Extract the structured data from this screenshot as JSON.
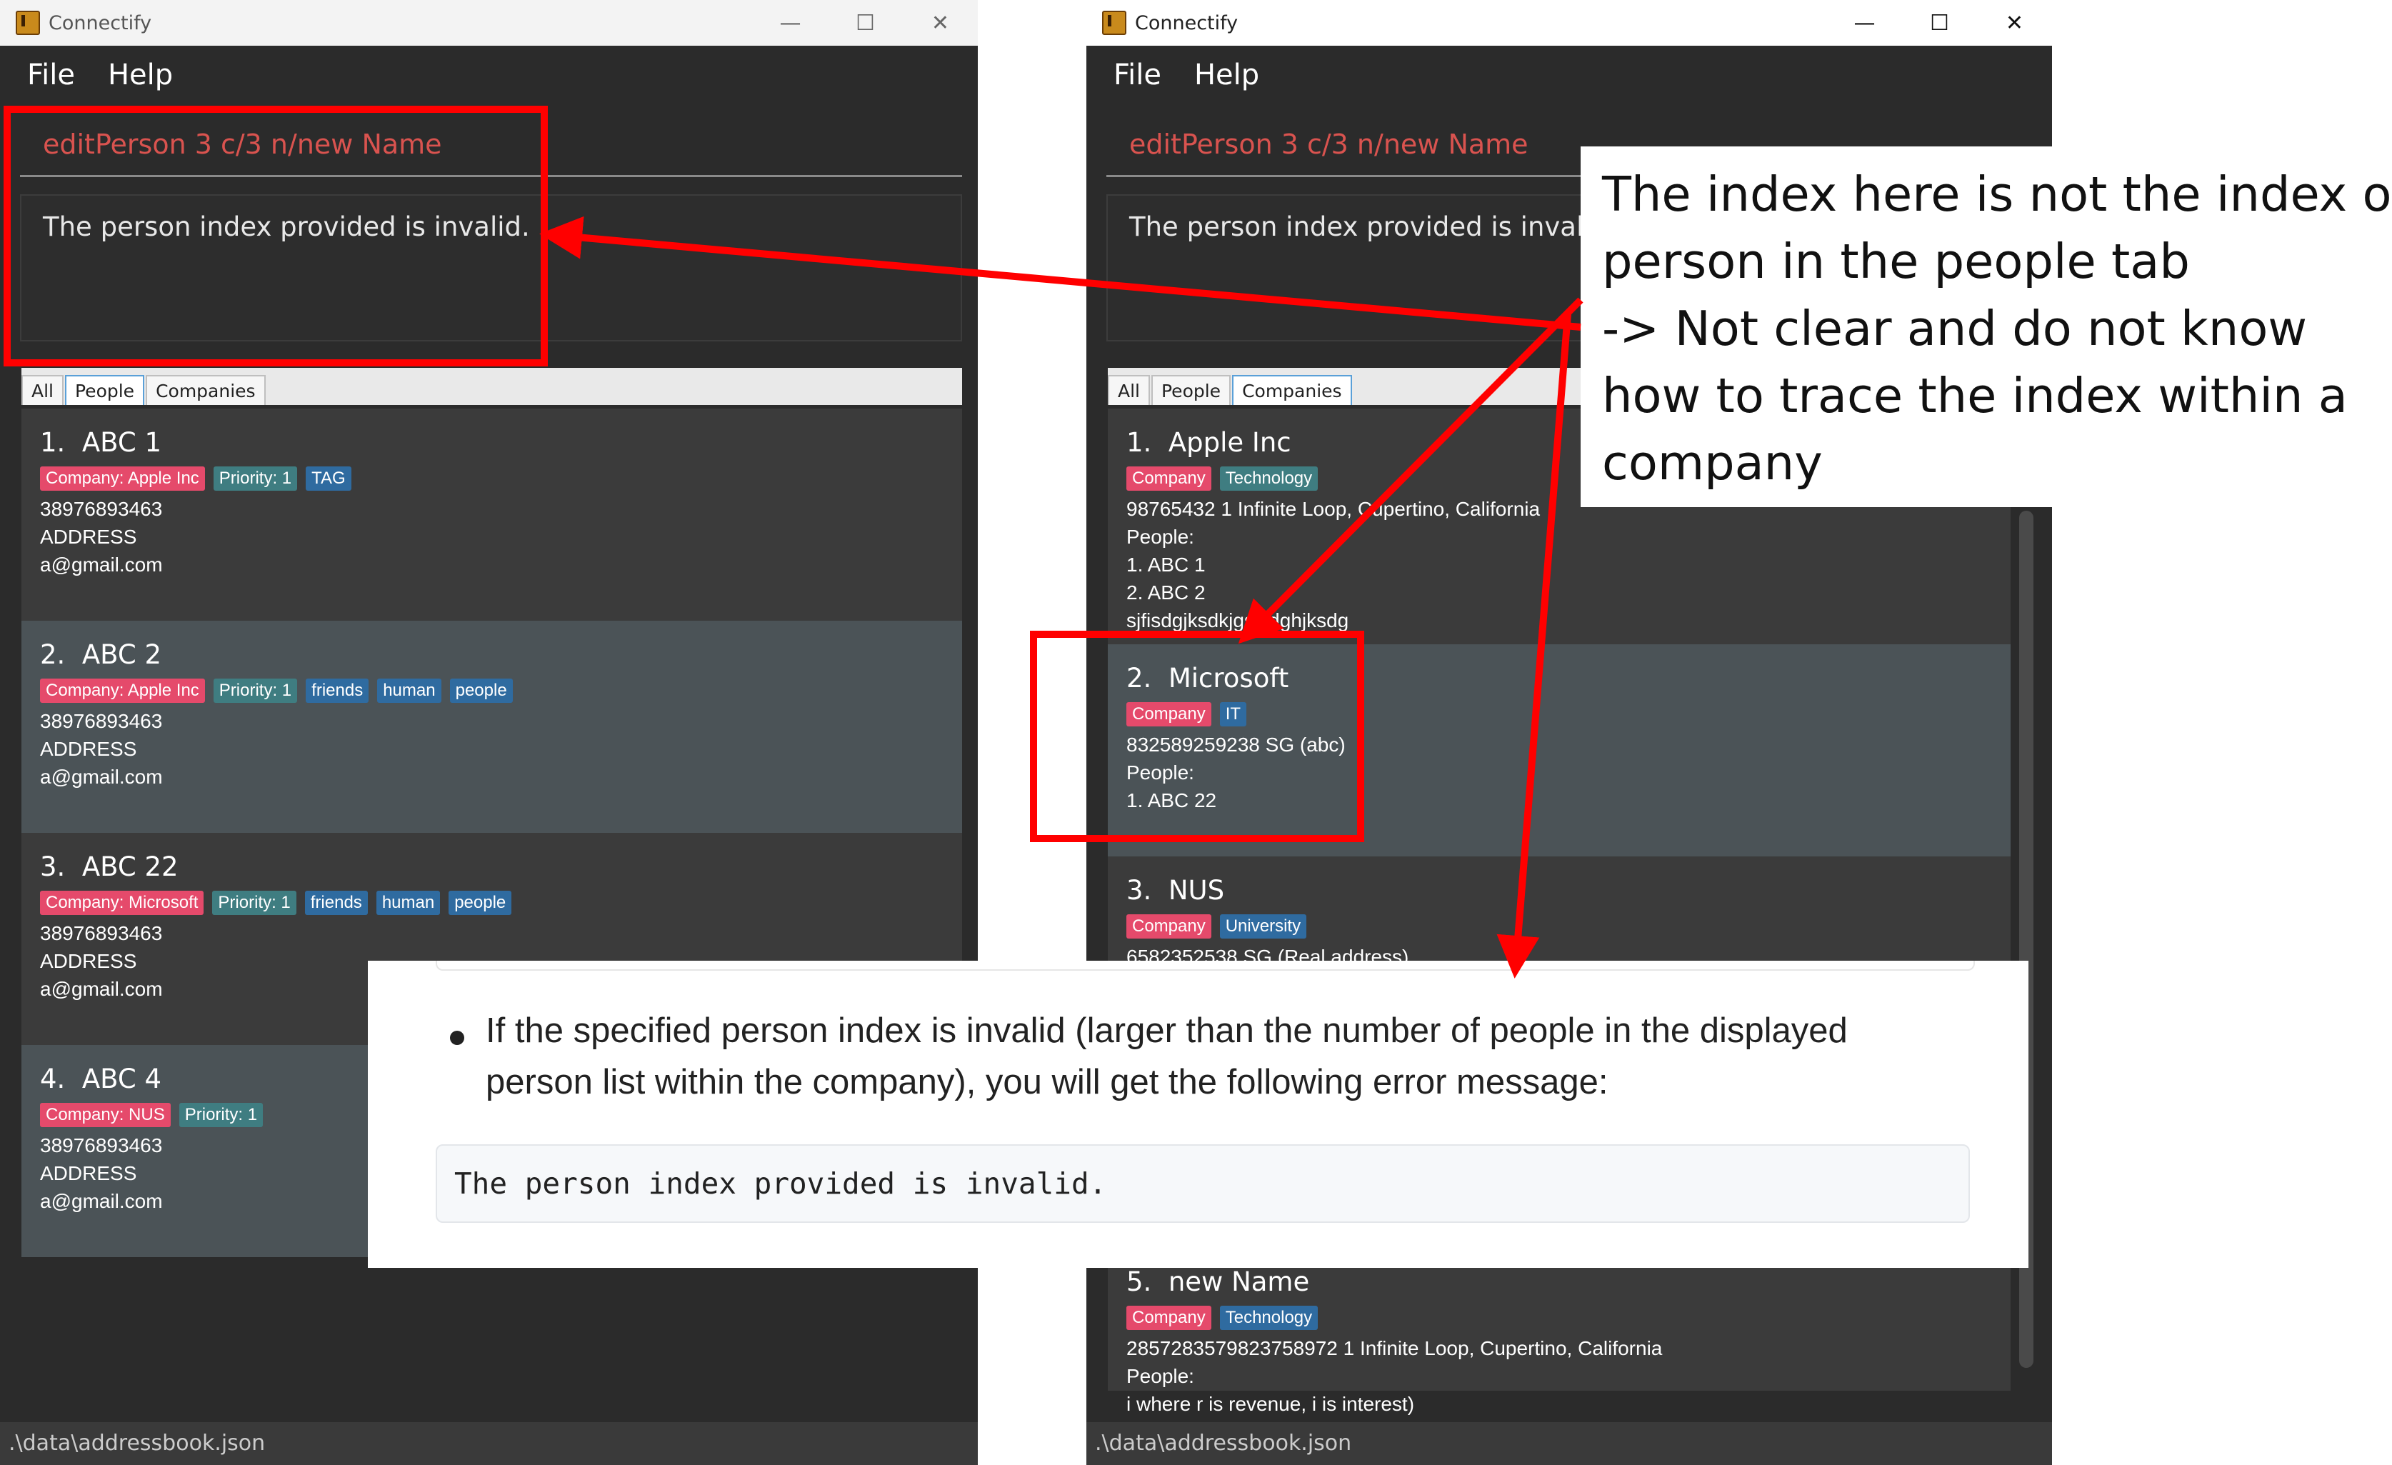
{
  "app": {
    "title": "Connectify",
    "menu": [
      "File",
      "Help"
    ],
    "status_path": ".\\data\\addressbook.json"
  },
  "window_controls": {
    "minimize": "—",
    "maximize": "☐",
    "close": "✕"
  },
  "left_window": {
    "command": "editPerson 3 c/3 n/new Name",
    "result": "The person index provided is invalid.",
    "tabs": [
      "All",
      "People",
      "Companies"
    ],
    "selected_tab": "All",
    "persons": [
      {
        "index": "1.",
        "name": "ABC 1",
        "tags": [
          {
            "text": "Company: Apple Inc",
            "kind": "company"
          },
          {
            "text": "Priority: 1",
            "kind": "priority"
          },
          {
            "text": "TAG",
            "kind": "normal"
          }
        ],
        "phone": "38976893463",
        "address": "ADDRESS",
        "email": "a@gmail.com"
      },
      {
        "index": "2.",
        "name": "ABC 2",
        "tags": [
          {
            "text": "Company: Apple Inc",
            "kind": "company"
          },
          {
            "text": "Priority: 1",
            "kind": "priority"
          },
          {
            "text": "friends",
            "kind": "normal"
          },
          {
            "text": "human",
            "kind": "normal"
          },
          {
            "text": "people",
            "kind": "normal"
          }
        ],
        "phone": "38976893463",
        "address": "ADDRESS",
        "email": "a@gmail.com"
      },
      {
        "index": "3.",
        "name": "ABC 22",
        "tags": [
          {
            "text": "Company: Microsoft",
            "kind": "company"
          },
          {
            "text": "Priority: 1",
            "kind": "priority"
          },
          {
            "text": "friends",
            "kind": "normal"
          },
          {
            "text": "human",
            "kind": "normal"
          },
          {
            "text": "people",
            "kind": "normal"
          }
        ],
        "phone": "38976893463",
        "address": "ADDRESS",
        "email": "a@gmail.com"
      },
      {
        "index": "4.",
        "name": "ABC 4",
        "tags": [
          {
            "text": "Company: NUS",
            "kind": "company"
          },
          {
            "text": "Priority: 1",
            "kind": "priority"
          }
        ],
        "phone": "38976893463",
        "address": "ADDRESS",
        "email": "a@gmail.com"
      }
    ]
  },
  "right_window": {
    "command": "editPerson 3 c/3 n/new Name",
    "result": "The person index provided is invalid.",
    "tabs": [
      "All",
      "People",
      "Companies"
    ],
    "selected_tab": "Companies",
    "companies": [
      {
        "index": "1.",
        "name": "Apple Inc",
        "tags": [
          {
            "text": "Company",
            "kind": "company"
          },
          {
            "text": "Technology",
            "kind": "priority"
          }
        ],
        "details": "98765432  1 Infinite Loop, Cupertino, California",
        "people_label": "People:",
        "people": [
          "1. ABC 1",
          "2. ABC 2"
        ],
        "extra": "sjfisdgjksdkjgsjsdghjksdg"
      },
      {
        "index": "2.",
        "name": "Microsoft",
        "tags": [
          {
            "text": "Company",
            "kind": "company"
          },
          {
            "text": "IT",
            "kind": "normal"
          }
        ],
        "details": "832589259238  SG (abc)",
        "people_label": "People:",
        "people": [
          "1. ABC 22"
        ]
      },
      {
        "index": "3.",
        "name": "NUS",
        "tags": [
          {
            "text": "Company",
            "kind": "company"
          },
          {
            "text": "University",
            "kind": "normal"
          }
        ],
        "details": "6582352538  SG (Real address)"
      },
      {
        "index": "5.",
        "name": "new Name",
        "tags": [
          {
            "text": "Company",
            "kind": "company"
          },
          {
            "text": "Technology",
            "kind": "normal"
          }
        ],
        "details": "2857283579823758972  1 Infinite Loop, Cupertino, California",
        "people_label": "People:",
        "extra": "i where r is revenue, i is interest)"
      }
    ]
  },
  "annotation": {
    "lines": [
      "The index here is not the index of",
      "person in the people tab",
      "-> Not clear and do not know",
      "how to trace the index within a",
      "company"
    ]
  },
  "doc_excerpt": {
    "bullet": "If the specified person index is invalid (larger than the number of people in the displayed person list within the company), you will get the following error message:",
    "code": "The person index provided is invalid."
  },
  "colors": {
    "highlight": "#ff0000",
    "company_tag": "#e54a6b",
    "priority_tag": "#3f7d81",
    "tag": "#2f6ba0",
    "error_text": "#d9534f"
  }
}
